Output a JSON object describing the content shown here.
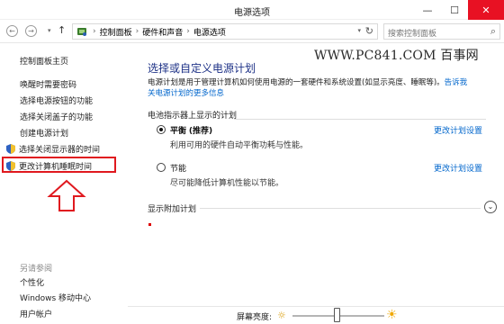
{
  "window": {
    "title": "电源选项",
    "minimize": "—",
    "maximize": "☐",
    "close": "✕"
  },
  "address": {
    "back": "←",
    "forward": "→",
    "dropdown": "▾",
    "up": "↑",
    "crumbs": [
      "控制面板",
      "硬件和声音",
      "电源选项"
    ],
    "separator": "›",
    "refresh": "↻",
    "search_placeholder": "搜索控制面板",
    "search_icon": "⌕"
  },
  "watermark": "WWW.PC841.COM 百事网",
  "sidebar": {
    "home": "控制面板主页",
    "links": [
      "唤醒时需要密码",
      "选择电源按钮的功能",
      "选择关闭盖子的功能",
      "创建电源计划",
      "选择关闭显示器的时间",
      "更改计算机睡眠时间"
    ],
    "see_also_title": "另请参阅",
    "see_also": [
      "个性化",
      "Windows 移动中心",
      "用户帐户"
    ],
    "highlight_color": "#e0191f"
  },
  "main": {
    "title": "选择或自定义电源计划",
    "desc_text": "电源计划是用于管理计算机如何使用电源的一套硬件和系统设置(如显示亮度、睡眠等)。",
    "desc_link_1": "告诉我",
    "desc_link_2": "关电源计划的更多信息",
    "battery_section": "电池指示器上显示的计划",
    "plans": [
      {
        "name": "平衡",
        "tag": "(推荐)",
        "desc": "利用可用的硬件自动平衡功耗与性能。",
        "link": "更改计划设置",
        "selected": true
      },
      {
        "name": "节能",
        "tag": "",
        "desc": "尽可能降低计算机性能以节能。",
        "link": "更改计划设置",
        "selected": false
      }
    ],
    "additional": "显示附加计划",
    "expand_icon": "⌄"
  },
  "bottom": {
    "brightness_label": "屏幕亮度:",
    "sun_dim": "☼",
    "sun_bright": "☀",
    "brightness_level_pct": 48
  },
  "colors": {
    "accent_blue": "#1e3287",
    "link": "#0066cc",
    "close_red": "#e81123"
  }
}
